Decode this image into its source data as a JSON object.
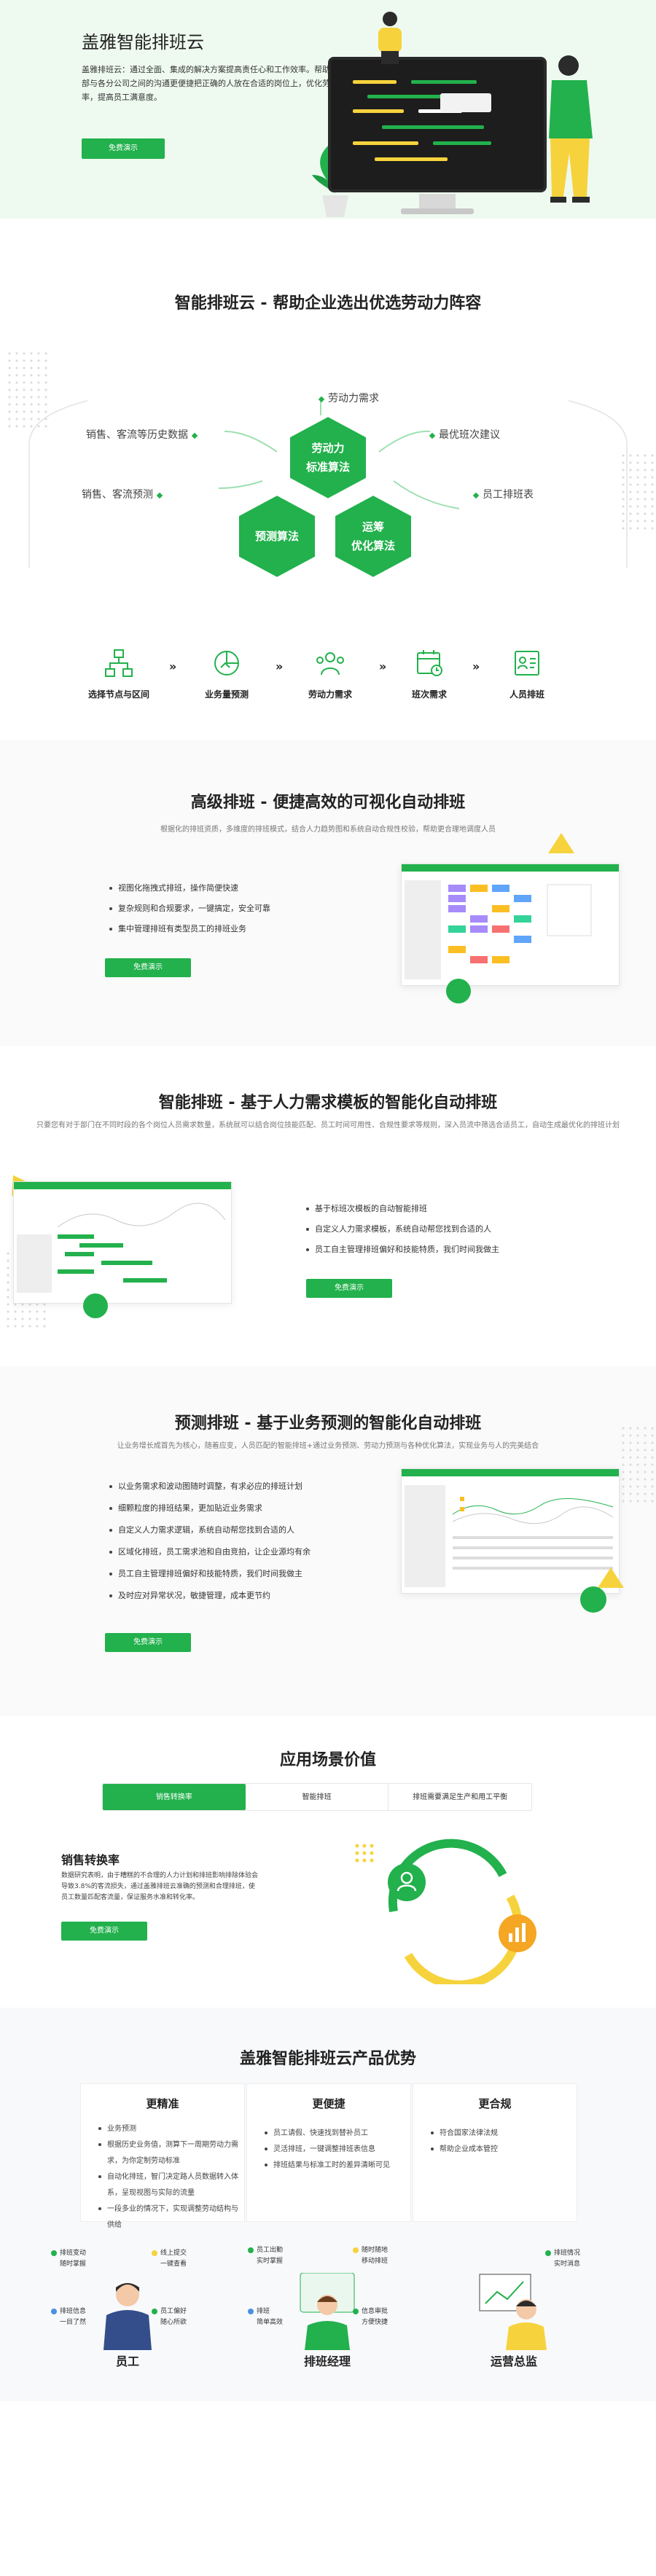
{
  "hero": {
    "title": "盖雅智能排班云",
    "description": "盖雅排班云：通过全面、集成的解决方案提高责任心和工作效率。帮助企业总部与各分公司之间的沟通更便捷把正确的人放在合适的岗位上，优化劳动力效率，提高员工满意度。",
    "cta": "免费演示"
  },
  "cloud": {
    "title": "智能排班云 - 帮助企业选出优选劳动力阵容",
    "hexes": [
      "劳动力\n标准算法",
      "预测算法",
      "运筹\n优化算法"
    ],
    "labels": {
      "demand": "劳动力需求",
      "history": "销售、客流等历史数据",
      "best": "最优班次建议",
      "forecast": "销售、客流预测",
      "schedule": "员工排班表"
    },
    "steps": [
      "选择节点与区间",
      "业务量预测",
      "劳动力需求",
      "班次需求",
      "人员排班"
    ]
  },
  "advanced": {
    "title": "高级排班 - 便捷高效的可视化自动排班",
    "subtitle": "根据化的排班资质，多维度的排班模式，结合人力趋势图和系统自动合规性校验，帮助更合理地调度人员",
    "items": [
      "视图化拖拽式排班，操作简便快速",
      "复杂规则和合规要求，一键搞定，安全可靠",
      "集中管理排班有类型员工的排班业务"
    ],
    "cta": "免费演示"
  },
  "template": {
    "title": "智能排班 - 基于人力需求模板的智能化自动排班",
    "subtitle": "只要您有对于部门在不同时段的各个岗位人员需求数量，系统就可以结合岗位技能匹配、员工时间可用性、合规性要求等规则，深入员流中筛选合适员工，自动生成最优化的排班计划",
    "items": [
      "基于标班次模板的自动智能排班",
      "自定义人力需求模板，系统自动帮您找到合适的人",
      "员工自主管理排班偏好和技能特质，我们时间我做主"
    ],
    "cta": "免费演示"
  },
  "predict": {
    "title": "预测排班 - 基于业务预测的智能化自动排班",
    "subtitle": "让业务增长成首先为核心，随着应变，人员匹配的智能排班+通过业务预测、劳动力预测与各种优化算法，实现业务与人的完美结合",
    "items": [
      "以业务需求和波动图随时调整，有求必应的排班计划",
      "细颗粒度的排班结果，更加贴近业务需求",
      "自定义人力需求逻辑，系统自动帮您找到合适的人",
      "区域化排班，员工需求池和自由竞拍，让企业源均有余",
      "员工自主管理排班偏好和技能特质，我们时间我做主",
      "及时应对异常状况，敏捷管理，成本更节约"
    ],
    "cta": "免费演示"
  },
  "scenes": {
    "title": "应用场景价值",
    "tabs": [
      "销售转换率",
      "智能排班",
      "排班需要满足生产和用工平衡"
    ],
    "active_title": "销售转换率",
    "active_desc": "数据研究表明，由于糟糕的不合理的人力计划和排班影响排除体验会导致3.8%的客流损失，通过盖雅排班云准确的预测和合理排班，使员工数量匹配客流量，保证服务水准和转化率。",
    "cta": "免费演示"
  },
  "advantages": {
    "title": "盖雅智能排班云产品优势",
    "cards": [
      {
        "title": "更精准",
        "items": [
          "业务预测",
          "根据历史业务值，测算下一周期劳动力需求，为你定制劳动标准",
          "自动化排班，智门决定路人员数据转入体系，呈现视图与实际的流量",
          "一段多业的情况下，实现调整劳动结构与供给"
        ]
      },
      {
        "title": "更便捷",
        "items": [
          "员工请假、快速找到替补员工",
          "灵活排班，一键调整排班表信息",
          "排班结果与标准工时的差异清晰可见"
        ]
      },
      {
        "title": "更合规",
        "items": [
          "符合国家法律法规",
          "帮助企业成本管控"
        ]
      }
    ],
    "personas": [
      {
        "name": "员工",
        "tags": [
          "排班变动\n随时掌握",
          "线上提交\n一键查看",
          "排班信息\n一目了然",
          "员工偏好\n随心所欲"
        ]
      },
      {
        "name": "排班经理",
        "tags": [
          "员工出勤\n实时掌握",
          "随时随地\n移动排班",
          "排班\n简单高效",
          "信息审批\n方便快捷"
        ]
      },
      {
        "name": "运营总监",
        "tags": [
          "排班情况\n实时消息"
        ]
      }
    ]
  },
  "colors": {
    "brand": "#22b14c",
    "accent_yellow": "#f6d33c",
    "light_green": "#eefaf0"
  }
}
